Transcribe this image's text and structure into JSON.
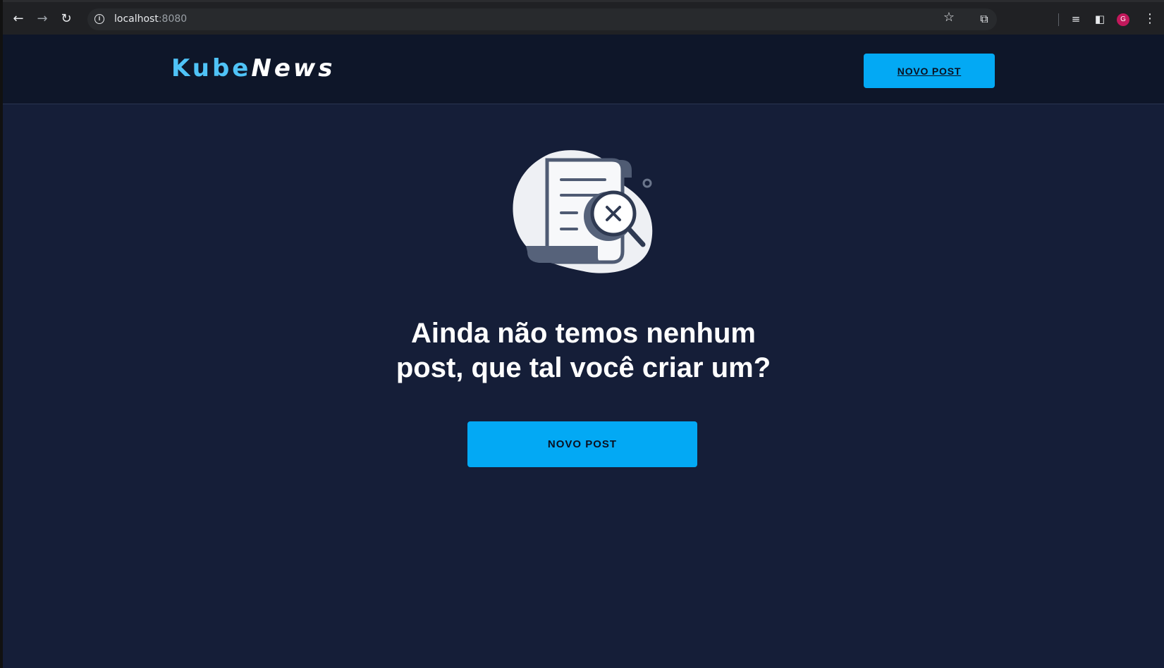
{
  "browser": {
    "url_host": "localhost",
    "url_port": ":8080",
    "profile_initial": "G"
  },
  "navbar": {
    "logo_part1": "Kube",
    "logo_part2": "News",
    "new_post_label": "NOVO POST"
  },
  "main": {
    "headline_line1": "Ainda não temos nenhum",
    "headline_line2": "post, que tal você criar um?",
    "cta_label": "NOVO POST",
    "illustration_icon": "document-search-not-found-icon"
  },
  "colors": {
    "accent": "#03a9f4",
    "logo_accent": "#4fc3f7",
    "background": "#151e38",
    "navbar": "#0e1629"
  }
}
